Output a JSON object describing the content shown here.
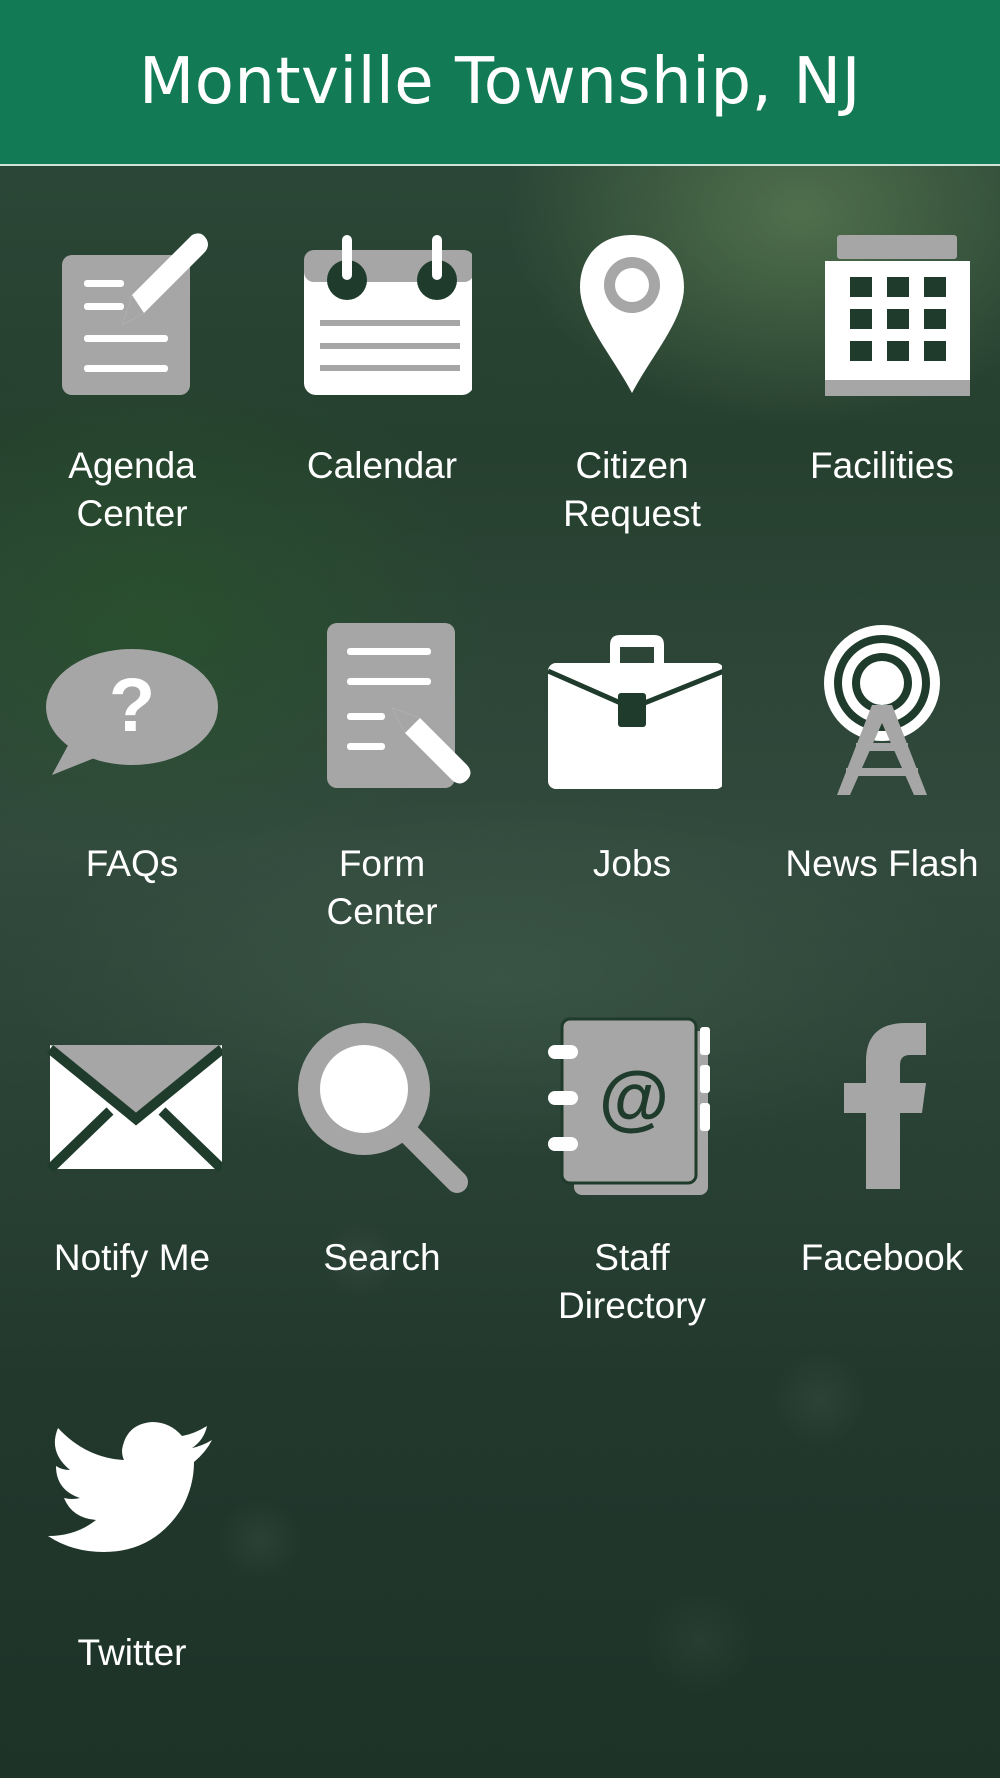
{
  "header": {
    "title": "Montville Township, NJ"
  },
  "tiles": [
    {
      "label_line1": "Agenda",
      "label_line2": "Center",
      "icon": "agenda-center-icon"
    },
    {
      "label_line1": "Calendar",
      "label_line2": "",
      "icon": "calendar-icon"
    },
    {
      "label_line1": "Citizen",
      "label_line2": "Request",
      "icon": "map-pin-icon"
    },
    {
      "label_line1": "Facilities",
      "label_line2": "",
      "icon": "building-icon"
    },
    {
      "label_line1": "FAQs",
      "label_line2": "",
      "icon": "question-bubble-icon"
    },
    {
      "label_line1": "Form",
      "label_line2": "Center",
      "icon": "form-document-icon"
    },
    {
      "label_line1": "Jobs",
      "label_line2": "",
      "icon": "briefcase-icon"
    },
    {
      "label_line1": "News Flash",
      "label_line2": "",
      "icon": "broadcast-tower-icon"
    },
    {
      "label_line1": "Notify Me",
      "label_line2": "",
      "icon": "envelope-icon"
    },
    {
      "label_line1": "Search",
      "label_line2": "",
      "icon": "magnifier-icon"
    },
    {
      "label_line1": "Staff",
      "label_line2": "Directory",
      "icon": "address-book-icon"
    },
    {
      "label_line1": "Facebook",
      "label_line2": "",
      "icon": "facebook-icon"
    },
    {
      "label_line1": "Twitter",
      "label_line2": "",
      "icon": "twitter-icon"
    }
  ],
  "colors": {
    "header": "#127a55",
    "icon_gray": "#a6a6a6",
    "icon_white": "#ffffff",
    "text": "#ffffff"
  }
}
